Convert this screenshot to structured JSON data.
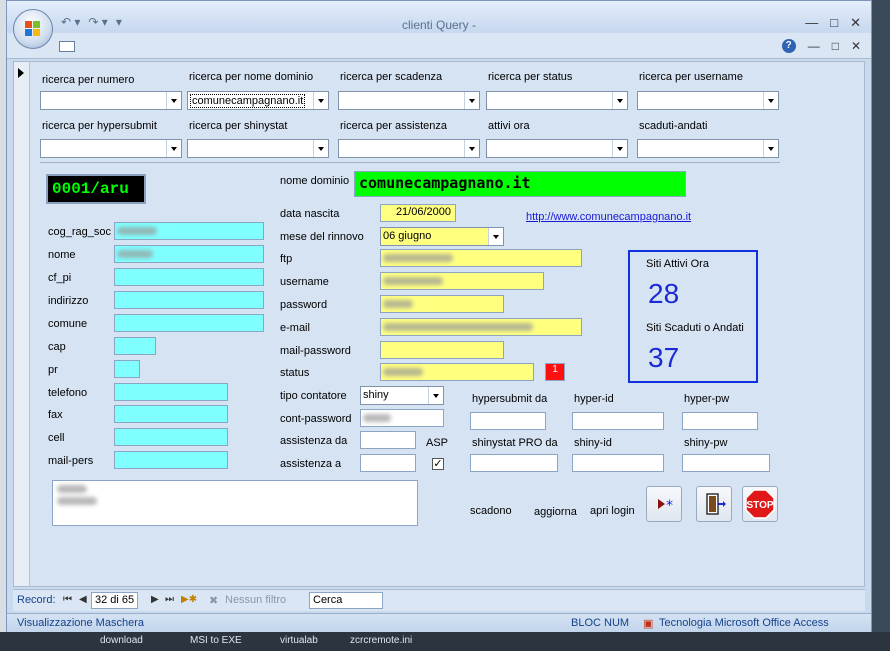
{
  "window": {
    "title": "clienti Query -",
    "controls": [
      "—",
      "□",
      "✕"
    ],
    "sub_controls": [
      "?",
      "—",
      "□",
      "✕"
    ]
  },
  "search": {
    "numero_label": "ricerca per numero",
    "dominio_label": "ricerca per nome dominio",
    "dominio_value": "comunecampagnano.it",
    "scadenza_label": "ricerca per scadenza",
    "status_label": "ricerca per status",
    "username_label": "ricerca per username",
    "hypersubmit_label": "ricerca per hypersubmit",
    "shinystat_label": "ricerca per shinystat",
    "assistenza_label": "ricerca per assistenza",
    "attivi_label": "attivi ora",
    "scaduti_label": "scaduti-andati"
  },
  "record": {
    "code": "0001/aru",
    "domain_label": "nome dominio",
    "domain_value": "comunecampagnano.it",
    "data_nascita_label": "data nascita",
    "data_nascita_value": "21/06/2000",
    "url": "http://www.comunecampagnano.it",
    "mese_rinnovo_label": "mese del rinnovo",
    "mese_rinnovo_value": "06 giugno",
    "ftp_label": "ftp",
    "username_label": "username",
    "password_label": "password",
    "email_label": "e-mail",
    "mail_password_label": "mail-password",
    "status_label": "status",
    "status_flag": "1",
    "tipo_contatore_label": "tipo contatore",
    "tipo_contatore_value": "shiny",
    "cont_password_label": "cont-password",
    "assistenza_da_label": "assistenza da",
    "assistenza_a_label": "assistenza a",
    "asp_label": "ASP",
    "asp_checked": "✓",
    "hypersubmit_da_label": "hypersubmit da",
    "hyper_id_label": "hyper-id",
    "hyper_pw_label": "hyper-pw",
    "shinystat_label": "shinystat PRO da",
    "shiny_id_label": "shiny-id",
    "shiny_pw_label": "shiny-pw"
  },
  "client": {
    "cog_label": "cog_rag_soc",
    "nome_label": "nome",
    "cf_label": "cf_pi",
    "indirizzo_label": "indirizzo",
    "comune_label": "comune",
    "cap_label": "cap",
    "pr_label": "pr",
    "telefono_label": "telefono",
    "fax_label": "fax",
    "cell_label": "cell",
    "mail_label": "mail-pers"
  },
  "stats": {
    "attivi_label": "Siti Attivi Ora",
    "attivi_value": "28",
    "scaduti_label": "Siti Scaduti o Andati",
    "scaduti_value": "37"
  },
  "actions": {
    "scadono": "scadono",
    "aggiorna": "aggiorna",
    "apri_login": "apri login"
  },
  "nav": {
    "record_label": "Record:",
    "record_value": "32 di 65",
    "filter_label": "Nessun filtro",
    "search_placeholder": "Cerca"
  },
  "status": {
    "view": "Visualizzazione Maschera",
    "numlock": "BLOC NUM",
    "tech": "Tecnologia Microsoft Office Access"
  },
  "taskbar": [
    "download",
    "MSI to EXE",
    "virtualab",
    "zcrcremote.ini"
  ],
  "colors": {
    "cyan_field": "#80ffff",
    "yellow_field": "#ffff80",
    "green_domain": "#00ff00",
    "stats_border": "#1030e0",
    "stop": "#e01818"
  }
}
